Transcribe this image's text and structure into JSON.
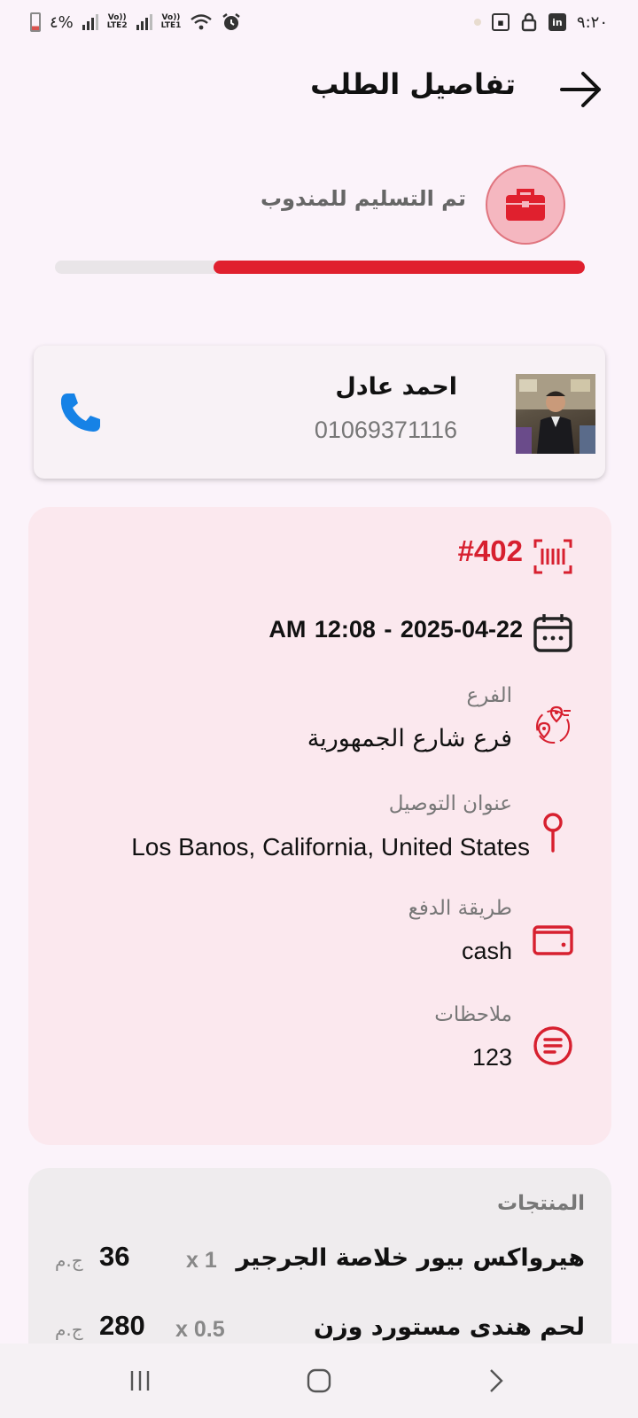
{
  "status_bar": {
    "time": "٩:٢٠",
    "battery": "٤%",
    "sim2": "LTE2",
    "sim1": "LTE1",
    "volte": "Vo))"
  },
  "header": {
    "title": "تفاصيل الطلب"
  },
  "order_status": {
    "label": "تم التسليم للمندوب",
    "progress_percent": 70,
    "accent": "#e0202e"
  },
  "driver": {
    "name": "احمد عادل",
    "phone": "01069371116"
  },
  "order": {
    "id": "#402",
    "date": "AM 12:08  -  2025-04-22",
    "branch_label": "الفرع",
    "branch_value": "فرع شارع الجمهورية",
    "address_label": "عنوان التوصيل",
    "address_value": "Los Banos, California, United States",
    "payment_label": "طريقة الدفع",
    "payment_value": "cash",
    "notes_label": "ملاحظات",
    "notes_value": "123"
  },
  "products": {
    "title": "المنتجات",
    "currency": "ج.م",
    "items": [
      {
        "name": "هيرواكس بيور خلاصة الجرجير",
        "qty": "x  1",
        "price": "36"
      },
      {
        "name": "لحم هندى مستورد وزن",
        "qty": "x  0.5",
        "price": "280"
      }
    ]
  },
  "icons": {
    "back": "arrow-right-icon",
    "status": "briefcase-icon",
    "call": "phone-icon",
    "order_id": "barcode-scan-icon",
    "date": "calendar-icon",
    "branch": "location-pins-icon",
    "address": "map-pin-icon",
    "payment": "wallet-icon",
    "notes": "notes-icon"
  }
}
